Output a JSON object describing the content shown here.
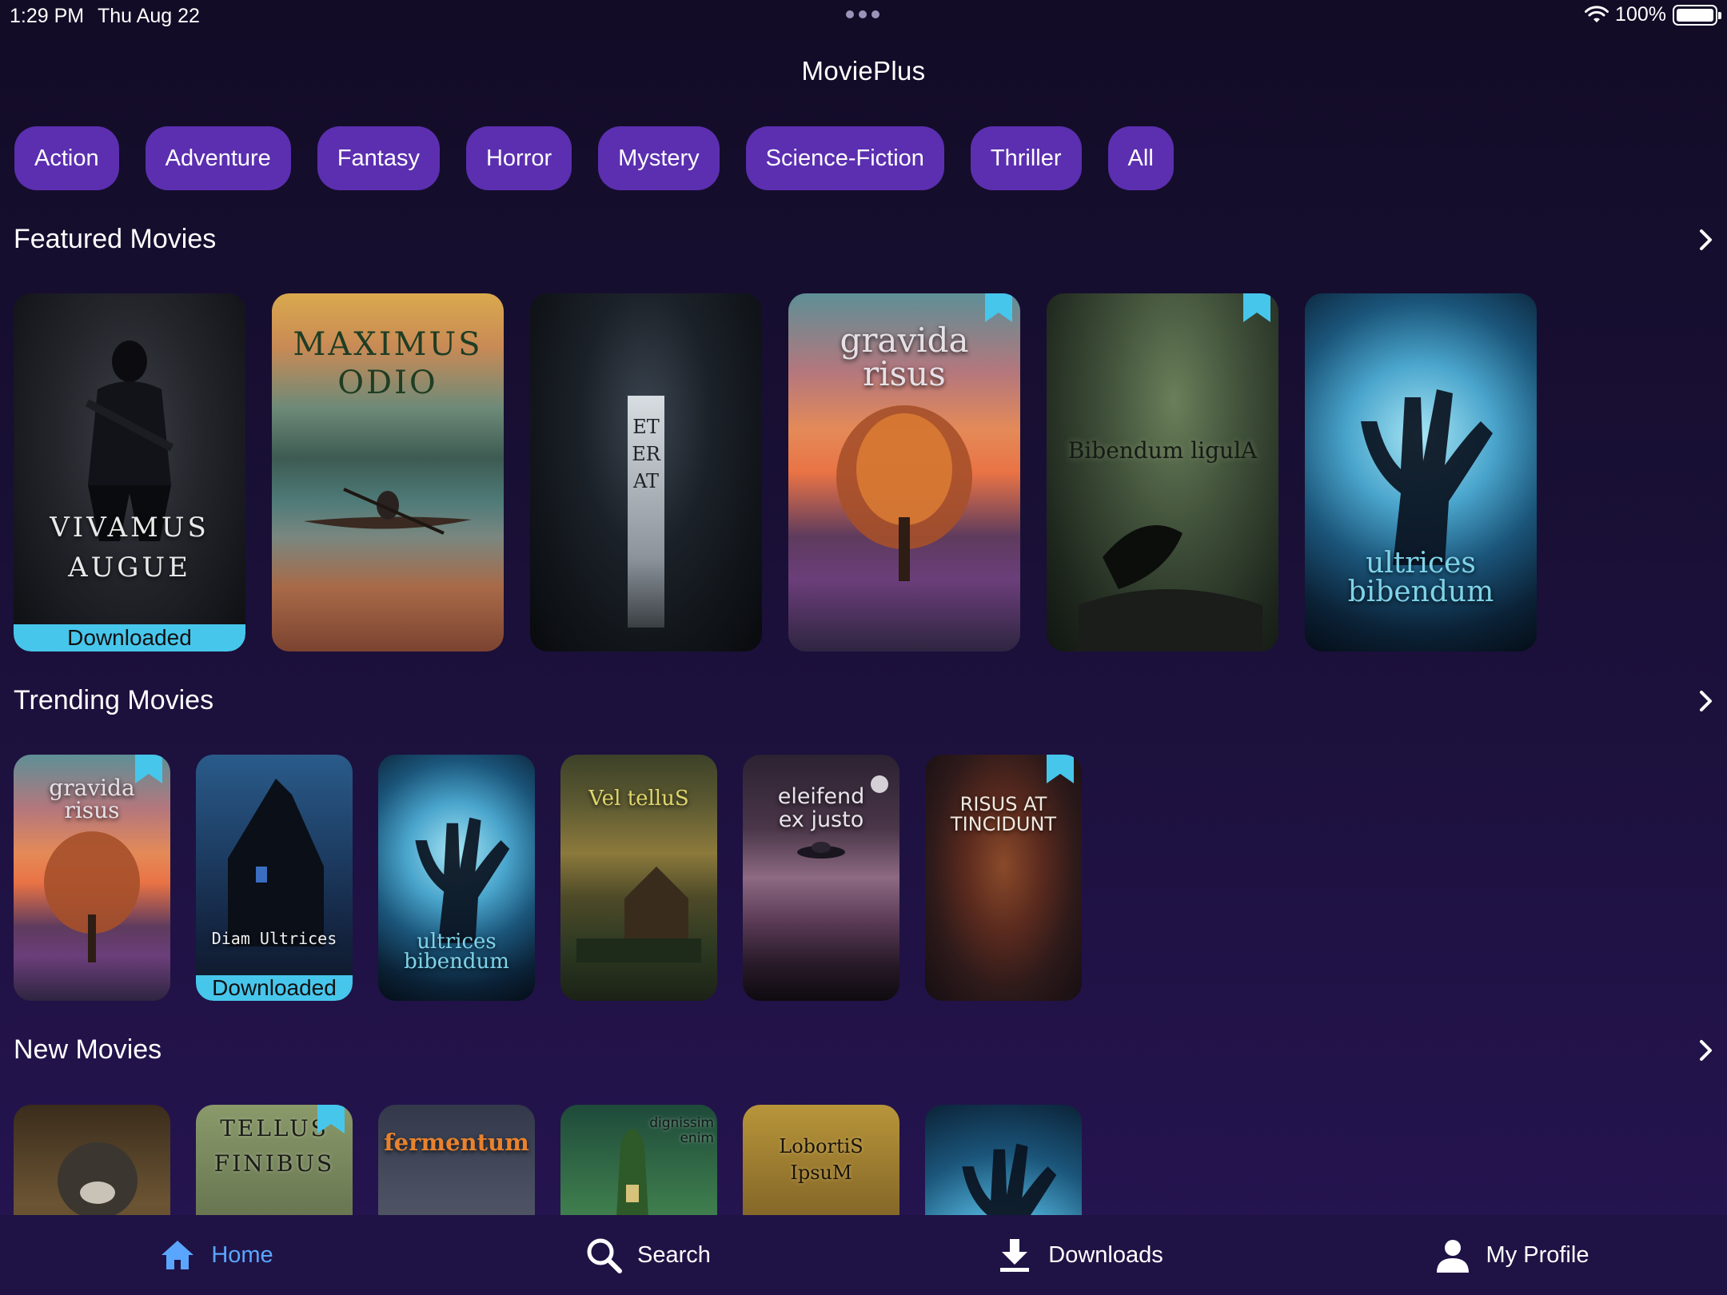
{
  "status": {
    "time": "1:29 PM",
    "date": "Thu Aug 22",
    "battery": "100%"
  },
  "app": {
    "title": "MoviePlus"
  },
  "genres": [
    "Action",
    "Adventure",
    "Fantasy",
    "Horror",
    "Mystery",
    "Science-Fiction",
    "Thriller",
    "All"
  ],
  "sections": {
    "featured": "Featured Movies",
    "trending": "Trending Movies",
    "new": "New Movies"
  },
  "featured": [
    {
      "title": "VIVAMUS AUGUE",
      "downloaded": "Downloaded"
    },
    {
      "title": "MAXIMUS ODIO"
    },
    {
      "title": "ET ERAT"
    },
    {
      "title": "gravida risus",
      "bookmarked": true
    },
    {
      "title": "Bibendum ligulA",
      "bookmarked": true
    },
    {
      "title": "ultrices bibendum"
    }
  ],
  "trending": [
    {
      "title": "gravida risus",
      "bookmarked": true
    },
    {
      "title": "Diam Ultrices",
      "downloaded": "Downloaded"
    },
    {
      "title": "ultrices bibendum"
    },
    {
      "title": "Vel telluS"
    },
    {
      "title": "eleifend ex justo"
    },
    {
      "title": "RISUS AT TINCIDUNT",
      "bookmarked": true
    }
  ],
  "new": [
    {
      "title": ""
    },
    {
      "title": "TELLUS FINIBUS",
      "bookmarked": true
    },
    {
      "title": "fermentum"
    },
    {
      "title": "dignissim enim"
    },
    {
      "title": "LobortiS IpsuM"
    },
    {
      "title": ""
    }
  ],
  "tabs": {
    "home": "Home",
    "search": "Search",
    "downloads": "Downloads",
    "profile": "My Profile"
  },
  "colors": {
    "chip": "#5b2fb0",
    "accent": "#5aa6ff",
    "badge": "#47c6ec",
    "bookmark": "#47c6ec"
  }
}
